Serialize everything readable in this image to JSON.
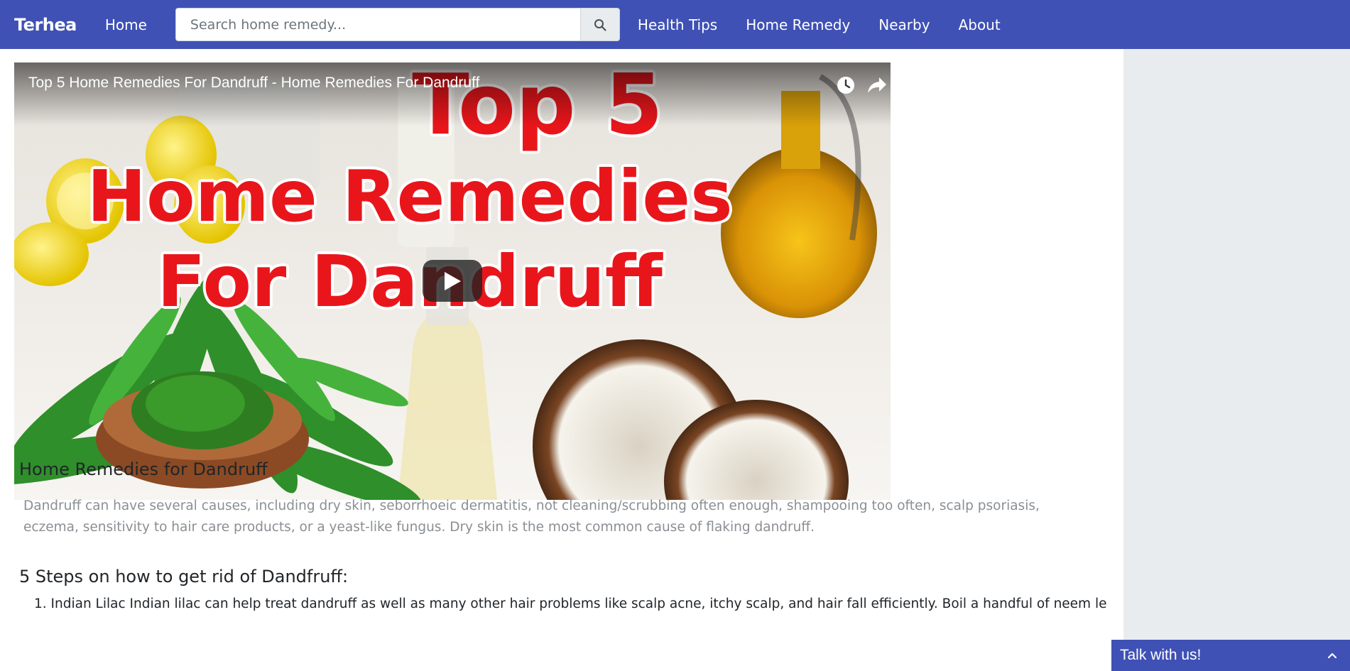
{
  "navbar": {
    "brand": "Terhea",
    "home": "Home",
    "search_placeholder": "Search home remedy...",
    "links": [
      "Health Tips",
      "Home Remedy",
      "Nearby",
      "About"
    ],
    "accent": "#3f51b5"
  },
  "video": {
    "title": "Top 5 Home Remedies For Dandruff - Home Remedies For Dandruff",
    "thumbnail_text": [
      "Top 5",
      "Home Remedies",
      "For Dandruff"
    ],
    "icons": [
      "watch-later-icon",
      "share-icon",
      "play-icon"
    ]
  },
  "article": {
    "title": "Home Remedies for Dandruff",
    "intro": "Dandruff can have several causes, including dry skin, seborrhoeic dermatitis, not cleaning/scrubbing often enough, shampooing too often, scalp psoriasis, eczema, sensitivity to hair care products, or a yeast-like fungus. Dry skin is the most common cause of flaking dandruff.",
    "steps_title": "5 Steps on how to get rid of Dandfruff:",
    "steps": [
      "Indian Lilac Indian lilac can help treat dandruff as well as many other hair problems like scalp acne, itchy scalp, and hair fall efficiently. Boil a handful of neem leaves in"
    ]
  },
  "chat": {
    "label": "Talk with us!"
  }
}
